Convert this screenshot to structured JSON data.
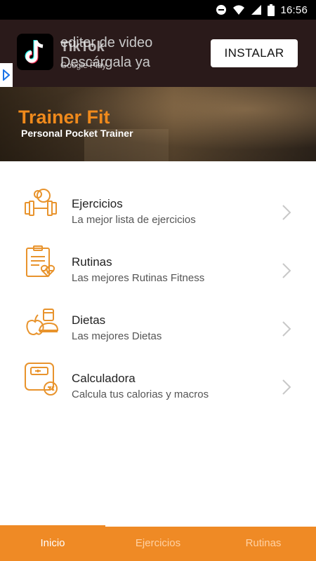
{
  "status_bar": {
    "time": "16:56",
    "icons": [
      "do-not-disturb-icon",
      "wifi-icon",
      "signal-icon",
      "battery-icon"
    ]
  },
  "ad": {
    "text_line1": "editor de video",
    "text_line2": "Descárgala ya",
    "overlay_title": "TikTok",
    "overlay_sub": "Google Play",
    "install_label": "INSTALAR"
  },
  "hero": {
    "title": "Trainer Fit",
    "subtitle": "Personal Pocket Trainer"
  },
  "menu": {
    "items": [
      {
        "title": "Ejercicios",
        "subtitle": "La mejor lista de ejercicios",
        "icon": "dumbbell-icon"
      },
      {
        "title": "Rutinas",
        "subtitle": "Las mejores Rutinas Fitness",
        "icon": "clipboard-heart-icon"
      },
      {
        "title": "Dietas",
        "subtitle": "Las mejores Dietas",
        "icon": "food-icon"
      },
      {
        "title": "Calculadora",
        "subtitle": "Calcula tus calorias y macros",
        "icon": "scale-icon"
      }
    ]
  },
  "bottom_nav": {
    "tabs": [
      {
        "label": "Inicio",
        "active": true
      },
      {
        "label": "Ejercicios",
        "active": false
      },
      {
        "label": "Rutinas",
        "active": false
      }
    ]
  },
  "colors": {
    "accent": "#ef8a25",
    "hero_title": "#f08a1c"
  }
}
